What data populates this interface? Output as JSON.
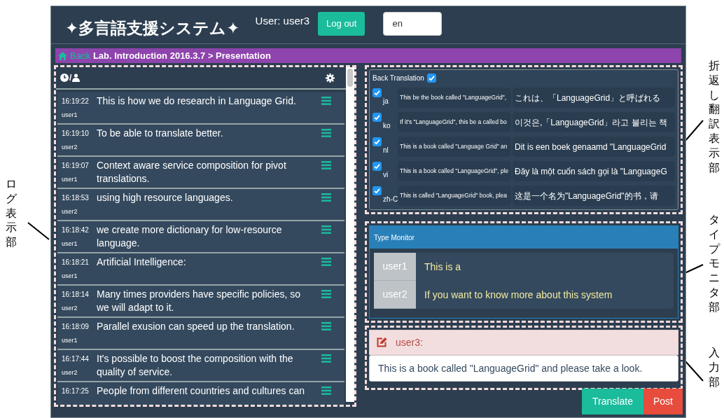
{
  "header": {
    "title": "✦多言語支援システム✦",
    "user_label": "User: user3",
    "logout_button": "Log out",
    "language": "en"
  },
  "breadcrumb": {
    "back": "Back",
    "path": "Lab. Introduction 2016.3.7 > Presentation"
  },
  "log": {
    "header_separator": "/",
    "entries": [
      {
        "time": "16:19:22",
        "user": "user1",
        "message": "This is how we do research in Language Grid."
      },
      {
        "time": "16:19:10",
        "user": "user2",
        "message": "To be able to translate better."
      },
      {
        "time": "16:19:07",
        "user": "user1",
        "message": "Context aware service composition for pivot translations."
      },
      {
        "time": "16:18:53",
        "user": "user2",
        "message": "using high resource languages."
      },
      {
        "time": "16:18:42",
        "user": "user1",
        "message": "we create more dictionary for low-resource language."
      },
      {
        "time": "16:18:21",
        "user": "user1",
        "message": "Artificial Intelligence:"
      },
      {
        "time": "16:18:14",
        "user": "user2",
        "message": "Many times providers have specific policies, so we will adapt to it."
      },
      {
        "time": "16:18:09",
        "user": "user1",
        "message": "Parallel exusion can speed up the translation."
      },
      {
        "time": "16:17:44",
        "user": "user2",
        "message": "It's possible to boost the composition with the quality of service."
      },
      {
        "time": "16:17:25",
        "message": "People from different countries and cultures can"
      }
    ]
  },
  "back_translation": {
    "label": "Back Translation",
    "checked": true,
    "rows": [
      {
        "lang": "ja",
        "checked": true,
        "back": "This be the book called \"LanguageGrid\",",
        "translation": "これは、「LanguageGrid」と呼ばれる"
      },
      {
        "lang": "ko",
        "checked": true,
        "back": "If it's \"LanguageGrid\", this be a called bo",
        "translation": "이것은,「LanguageGrid」라고 불리는 책"
      },
      {
        "lang": "nl",
        "checked": true,
        "back": "This is a book called \"Language Grid\" an",
        "translation": "Dit is een boek genaamd \"LanguageGrid"
      },
      {
        "lang": "vi",
        "checked": true,
        "back": "This is a book called \"LanguageGrid\", ple",
        "translation": "Đây là một cuốn sách gọi là \"LanguageG"
      },
      {
        "lang": "zh-C",
        "checked": true,
        "back": "This is called \"LanguageGrid\" book, plea",
        "translation": "这是一个名为\"LanguageGrid\"的书，请"
      }
    ]
  },
  "type_monitor": {
    "title": "Type Monitor",
    "rows": [
      {
        "user": "user1",
        "text": "This is a"
      },
      {
        "user": "user2",
        "text": "If you want to know more about this system"
      }
    ]
  },
  "input": {
    "user": "user3:",
    "value": "This is a book called \"LanguageGrid\" and please take a look."
  },
  "buttons": [
    {
      "label": "Translate",
      "kind": "translate"
    },
    {
      "label": "Post",
      "kind": "post"
    }
  ],
  "left_annotations": [
    {
      "text": "ログ表示部"
    }
  ],
  "right_annotations": [
    {
      "text": "折返し翻訳表示部"
    },
    {
      "text": "タイプモニタ部"
    },
    {
      "text": "入力部"
    }
  ]
}
